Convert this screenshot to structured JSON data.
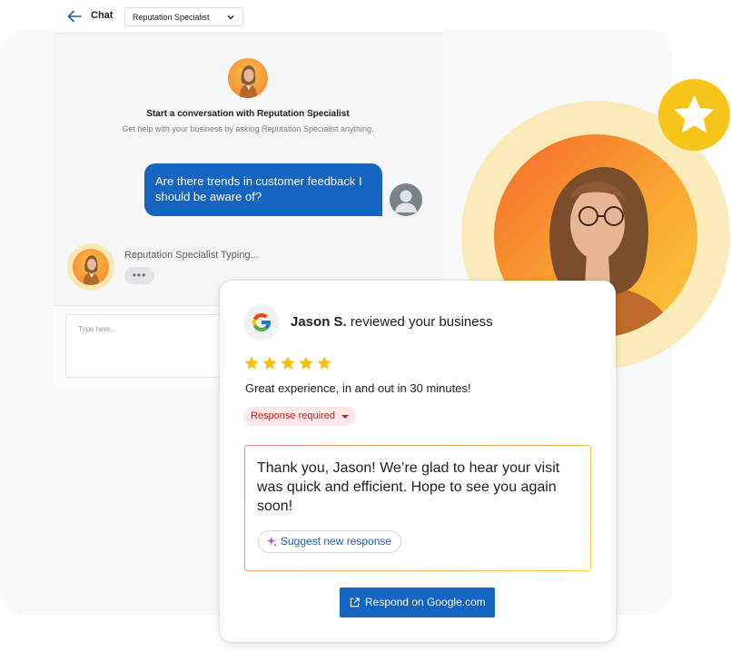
{
  "chat": {
    "title": "Chat",
    "agent_select": "Reputation Specialist",
    "intro_title": "Start a conversation with Reputation Specialist",
    "intro_subtitle": "Get help with your business by asking Reputation Specialist anything.",
    "user_message": "Are there trends in customer feedback I should be aware of?",
    "typing_status": "Reputation Specialist Typing...",
    "typing_dots": "•••",
    "input_placeholder": "Type here..."
  },
  "review": {
    "reviewer_name": "Jason S.",
    "reviewer_action": "reviewed your business",
    "star_rating": 5,
    "star_max": 5,
    "review_text": "Great experience, in and out in 30 minutes!",
    "status_label": "Response required",
    "response_text": "Thank you, Jason! We’re glad to hear your visit was quick and efficient. Hope to see you again soon!",
    "suggest_label": "Suggest new response",
    "respond_label": "Respond on Google.com"
  },
  "colors": {
    "primary": "#1565c0",
    "star": "#fbbc04",
    "badge": "#f7c51a",
    "halo": "#fbeab5",
    "status_bg": "#fce8e8",
    "status_text": "#c5221f"
  },
  "icons": {
    "back": "back-arrow-icon",
    "chevron": "chevron-down-icon",
    "user": "user-avatar-icon",
    "badge": "star-icon",
    "google": "google-icon",
    "sparkle": "sparkle-icon",
    "external": "external-link-icon"
  }
}
